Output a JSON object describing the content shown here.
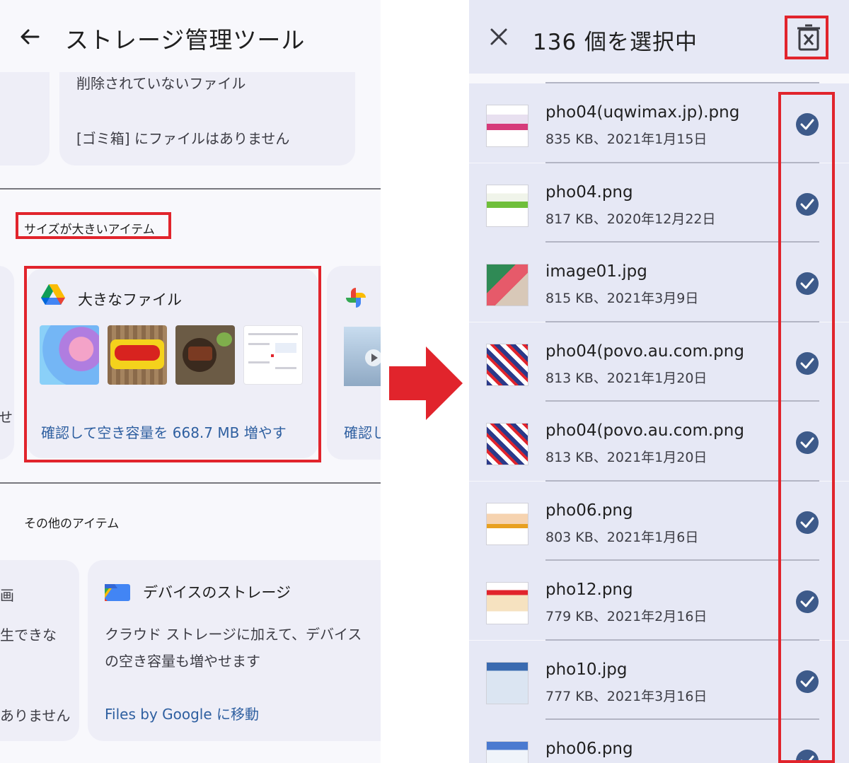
{
  "left_panel": {
    "header": {
      "title": "ストレージ管理ツール"
    },
    "trash_card": {
      "line1": "削除されていないファイル",
      "line2": "[ゴミ箱] にファイルはありません"
    },
    "large_items": {
      "section_label": "サイズが大きいアイテム",
      "card_title": "大きなファイル",
      "link": "確認して空き容量を 668.7 MB 増やす",
      "thumbnails": [
        "abstract-wallpaper",
        "dennys-sign",
        "steak-meal",
        "screenshot-doc"
      ],
      "next_card_link": "確認し"
    },
    "other_items": {
      "section_label": "その他のアイテム",
      "left_card_lines": [
        "画",
        "生できな",
        "ありません"
      ],
      "left_card_edge_text": "せ",
      "device_title": "デバイスのストレージ",
      "device_desc": "クラウド ストレージに加えて、デバイスの空き容量も増やせます",
      "device_link": "Files by Google に移動"
    }
  },
  "right_panel": {
    "header": {
      "title": "136 個を選択中"
    },
    "files": [
      {
        "name": "pho04(uqwimax.jp).png",
        "meta": "835 KB、2021年1月15日",
        "selected": true
      },
      {
        "name": "pho04.png",
        "meta": "817 KB、2020年12月22日",
        "selected": true
      },
      {
        "name": "image01.jpg",
        "meta": "815 KB、2021年3月9日",
        "selected": true
      },
      {
        "name": "pho04(povo.au.com.png",
        "meta": "813 KB、2021年1月20日",
        "selected": true
      },
      {
        "name": "pho04(povo.au.com.png",
        "meta": "813 KB、2021年1月20日",
        "selected": true
      },
      {
        "name": "pho06.png",
        "meta": "803 KB、2021年1月6日",
        "selected": true
      },
      {
        "name": "pho12.png",
        "meta": "779 KB、2021年2月16日",
        "selected": true
      },
      {
        "name": "pho10.jpg",
        "meta": "777 KB、2021年3月16日",
        "selected": true
      },
      {
        "name": "pho06.png",
        "meta": "",
        "selected": true
      }
    ]
  },
  "colors": {
    "highlight_red": "#e1242c",
    "link_blue": "#2e5fa0",
    "check_blue": "#3d5a8a",
    "selected_row_bg": "#e6e8f5",
    "card_bg": "#eeeef7"
  }
}
